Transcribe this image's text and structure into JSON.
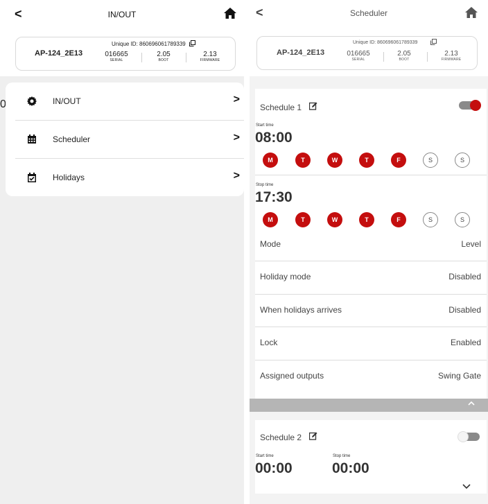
{
  "left": {
    "title": "IN/OUT",
    "device": {
      "name": "AP-124_2E13",
      "unique_id": "Unique ID: 860696061789339",
      "serial_value": "016665",
      "serial_label": "SERIAL",
      "boot_value": "2.05",
      "boot_label": "BOOT",
      "firmware_value": "2.13",
      "firmware_label": "FIRMWARE"
    },
    "edge_text": "0",
    "menu": [
      {
        "label": "IN/OUT",
        "icon": "gear-icon"
      },
      {
        "label": "Scheduler",
        "icon": "calendar-icon"
      },
      {
        "label": "Holidays",
        "icon": "calendar-check-icon"
      }
    ]
  },
  "right": {
    "title": "Scheduler",
    "device": {
      "name": "AP-124_2E13",
      "unique_id": "Unique ID: 860696061789339",
      "serial_value": "016665",
      "serial_label": "SERIAL",
      "boot_value": "2.05",
      "boot_label": "BOOT",
      "firmware_value": "2.13",
      "firmware_label": "FIRMWARE"
    },
    "schedule1": {
      "title": "Schedule 1",
      "enabled": true,
      "start_label": "Start time",
      "start_time": "08:00",
      "stop_label": "Stop time",
      "stop_time": "17:30",
      "start_days": [
        {
          "d": "M",
          "on": true
        },
        {
          "d": "T",
          "on": true
        },
        {
          "d": "W",
          "on": true
        },
        {
          "d": "T",
          "on": true
        },
        {
          "d": "F",
          "on": true
        },
        {
          "d": "S",
          "on": false
        },
        {
          "d": "S",
          "on": false
        }
      ],
      "stop_days": [
        {
          "d": "M",
          "on": true
        },
        {
          "d": "T",
          "on": true
        },
        {
          "d": "W",
          "on": true
        },
        {
          "d": "T",
          "on": true
        },
        {
          "d": "F",
          "on": true
        },
        {
          "d": "S",
          "on": false
        },
        {
          "d": "S",
          "on": false
        }
      ],
      "settings": [
        {
          "label": "Mode",
          "value": "Level"
        },
        {
          "label": "Holiday mode",
          "value": "Disabled"
        },
        {
          "label": "When holidays arrives",
          "value": "Disabled"
        },
        {
          "label": "Lock",
          "value": "Enabled"
        },
        {
          "label": "Assigned outputs",
          "value": "Swing Gate"
        }
      ]
    },
    "schedule2": {
      "title": "Schedule 2",
      "enabled": false,
      "start_label": "Start time",
      "start_time": "00:00",
      "stop_label": "Stop time",
      "stop_time": "00:00"
    }
  },
  "colors": {
    "accent": "#c40e0e",
    "toggle_on_track": "#8a8a8a",
    "toggle_off_track": "#8a8a8a",
    "collapse_bar": "#b5b5b5"
  }
}
